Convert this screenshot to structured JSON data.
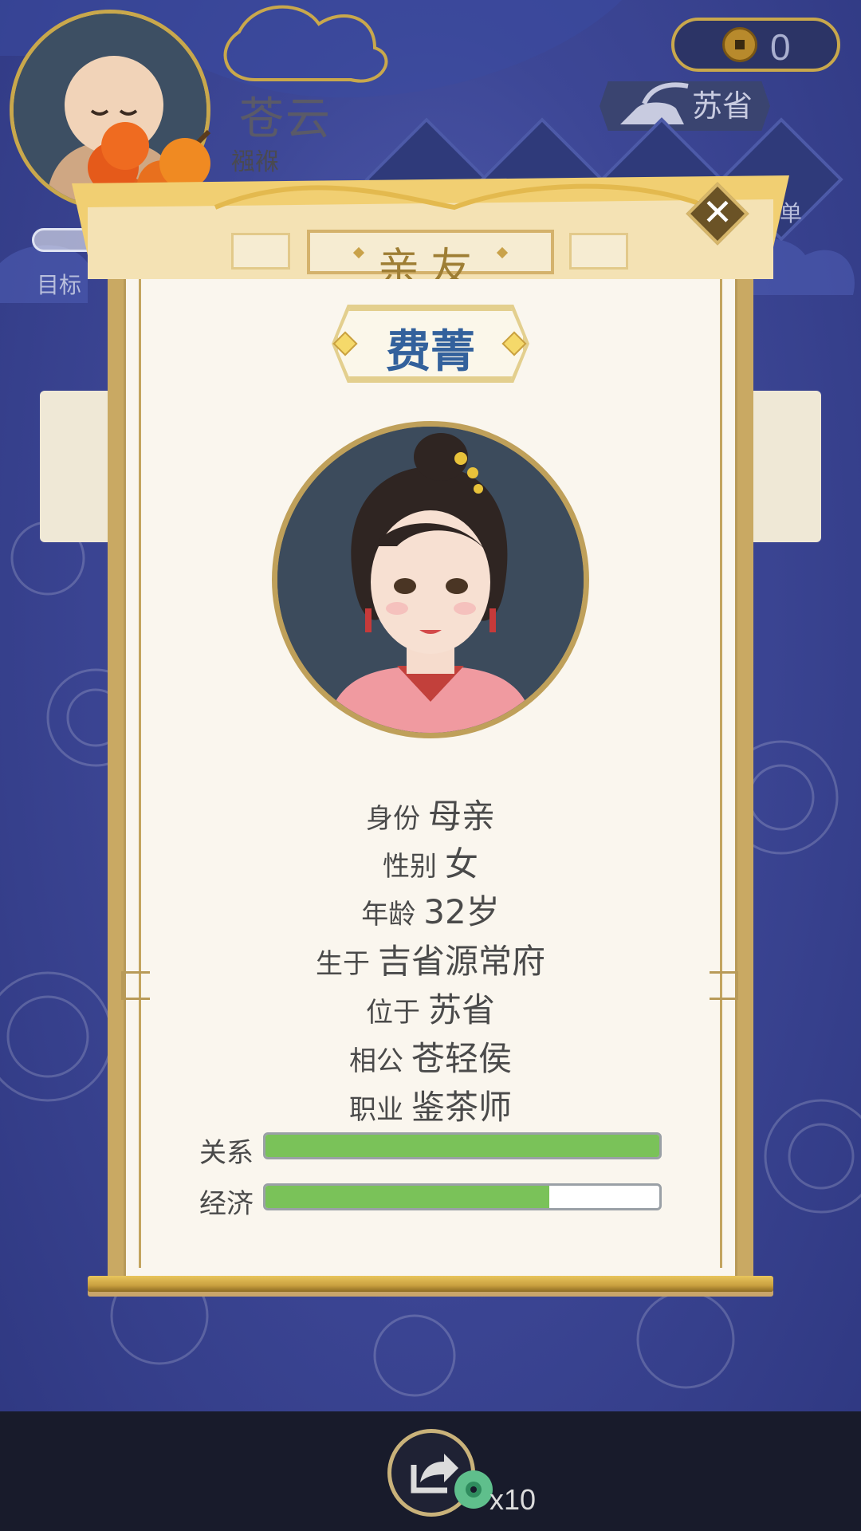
{
  "hud": {
    "player_name": "苍云",
    "player_stage": "襁褓",
    "coins": "0",
    "location": "苏省",
    "goal_label": "目标",
    "menu_right_label": "单"
  },
  "dialog": {
    "title": "亲友",
    "close_icon": "close-icon",
    "person_name": "费菁",
    "info": [
      {
        "label": "身份",
        "value": "母亲"
      },
      {
        "label": "性别",
        "value": "女"
      },
      {
        "label": "年龄",
        "value": "32岁"
      },
      {
        "label": "生于",
        "value": "吉省源常府"
      },
      {
        "label": "位于",
        "value": "苏省"
      },
      {
        "label": "相公",
        "value": "苍轻侯"
      },
      {
        "label": "职业",
        "value": "鉴茶师"
      }
    ],
    "bars": [
      {
        "label": "关系",
        "fraction": 1.0
      },
      {
        "label": "经济",
        "fraction": 0.72
      }
    ]
  },
  "bottom": {
    "share_icon": "share-icon",
    "count": "x10"
  },
  "colors": {
    "accent_gold": "#c9a963",
    "name_blue": "#33619c",
    "bar_green": "#7ac259",
    "background_blue": "#3d4796"
  }
}
